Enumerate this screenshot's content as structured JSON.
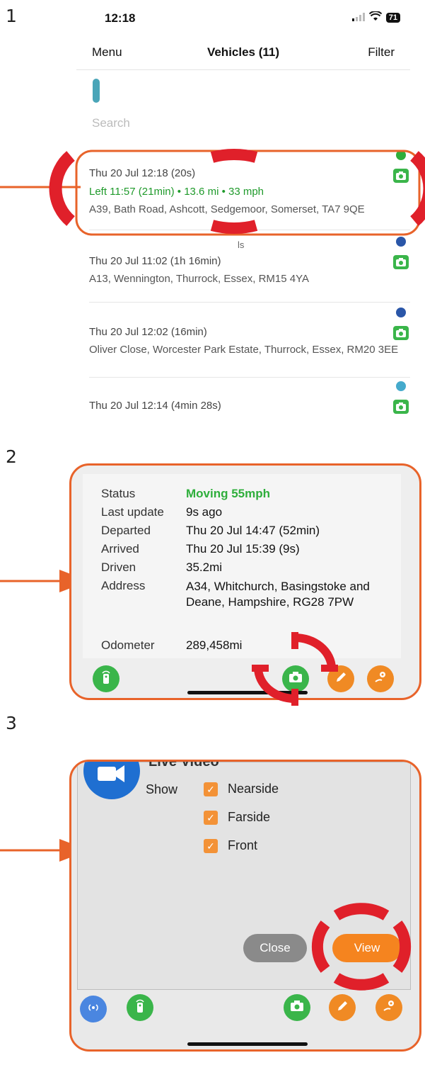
{
  "steps": {
    "one": "1",
    "two": "2",
    "three": "3"
  },
  "colors": {
    "accent_orange": "#e8632a",
    "highlight_red": "#e0202a",
    "moving_green": "#2eae3b"
  },
  "step1": {
    "status_bar": {
      "time": "12:18",
      "signal": "signal-icon",
      "wifi": "wifi-icon",
      "battery": "71"
    },
    "nav": {
      "left": "Menu",
      "title": "Vehicles (11)",
      "right": "Filter"
    },
    "search_placeholder": "Search",
    "vehicles": [
      {
        "time": "Thu 20 Jul 12:18 (20s)",
        "status": "Left 11:57 (21min) • 13.6 mi • 33 mph",
        "address": "A39, Bath Road, Ashcott, Sedgemoor, Somerset, TA7 9QE",
        "dot_color": "#2eae3b"
      },
      {
        "partial_label": "ls",
        "time": "Thu 20 Jul 11:02 (1h 16min)",
        "address": "A13, Wennington, Thurrock, Essex, RM15 4YA",
        "dot_color": "#2a56a8"
      },
      {
        "time": "Thu 20 Jul 12:02 (16min)",
        "address": "Oliver Close, Worcester Park Estate, Thurrock, Essex, RM20 3EE",
        "dot_color": "#2a56a8"
      },
      {
        "time": "Thu 20 Jul 12:14 (4min 28s)",
        "dot_color": "#45aacc"
      }
    ]
  },
  "step2": {
    "details": [
      {
        "label": "Status",
        "value": "Moving 55mph"
      },
      {
        "label": "Last update",
        "value": "9s ago"
      },
      {
        "label": "Departed",
        "value": "Thu 20 Jul 14:47 (52min)"
      },
      {
        "label": "Arrived",
        "value": "Thu 20 Jul 15:39 (9s)"
      },
      {
        "label": "Driven",
        "value": "35.2mi"
      },
      {
        "label": "Address",
        "value": "A34, Whitchurch, Basingstoke and Deane, Hampshire, RG28 7PW"
      },
      {
        "label": "Odometer",
        "value": "289,458mi"
      }
    ]
  },
  "step3": {
    "title_partial": "Live Video",
    "show_label": "Show",
    "options": [
      "Nearside",
      "Farside",
      "Front"
    ],
    "close_label": "Close",
    "view_label": "View"
  }
}
